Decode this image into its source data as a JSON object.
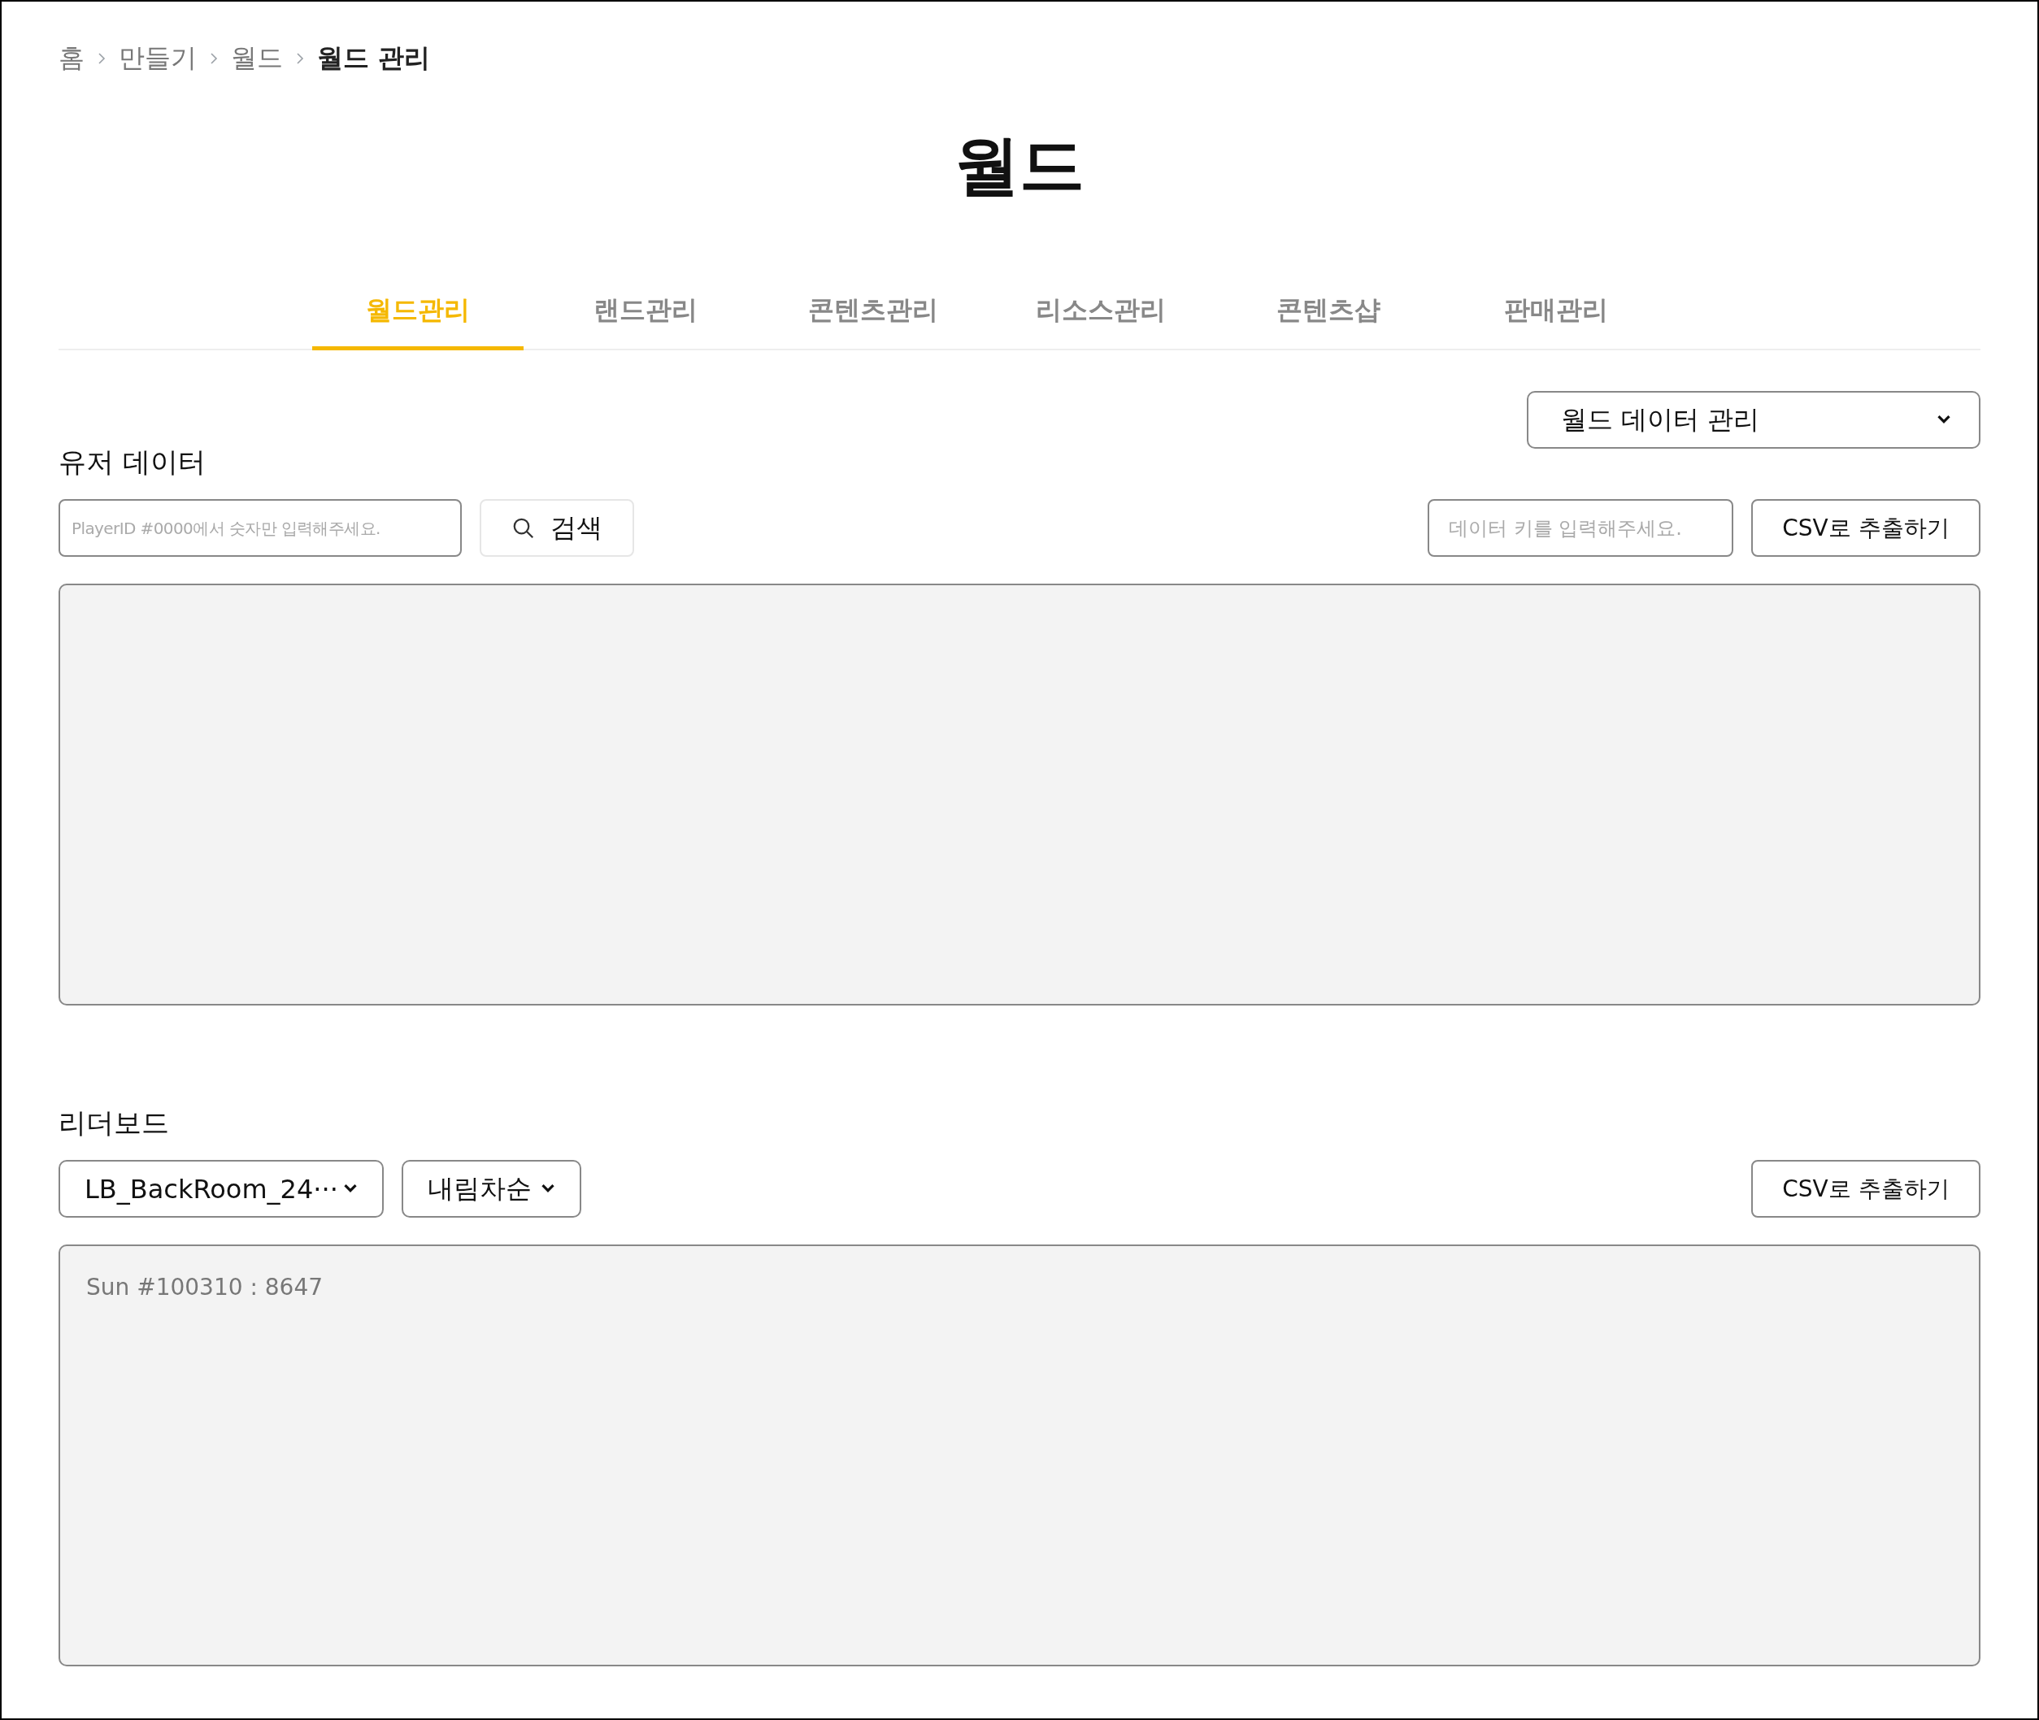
{
  "breadcrumb": [
    {
      "label": "홈",
      "current": false
    },
    {
      "label": "만들기",
      "current": false
    },
    {
      "label": "월드",
      "current": false
    },
    {
      "label": "월드 관리",
      "current": true
    }
  ],
  "title": "월드",
  "tabs": [
    {
      "label": "월드관리",
      "selected": true
    },
    {
      "label": "랜드관리",
      "selected": false
    },
    {
      "label": "콘텐츠관리",
      "selected": false
    },
    {
      "label": "리소스관리",
      "selected": false
    },
    {
      "label": "콘텐츠샵",
      "selected": false
    },
    {
      "label": "판매관리",
      "selected": false
    }
  ],
  "data_select": {
    "value": "월드 데이터 관리"
  },
  "user_data": {
    "heading": "유저 데이터",
    "player_field": {
      "placeholder": "PlayerID #0000에서 숫자만 입력해주세요."
    },
    "search_button": "검색",
    "key_field": {
      "placeholder": "데이터 키를 입력해주세요."
    },
    "export_button": "CSV로 추출하기"
  },
  "leaderboard": {
    "heading": "리더보드",
    "board_select": {
      "value": "LB_BackRoom_24···"
    },
    "order_select": {
      "value": "내림차순"
    },
    "export_button": "CSV로 추출하기",
    "entries": [
      "Sun #100310 : 8647"
    ]
  }
}
